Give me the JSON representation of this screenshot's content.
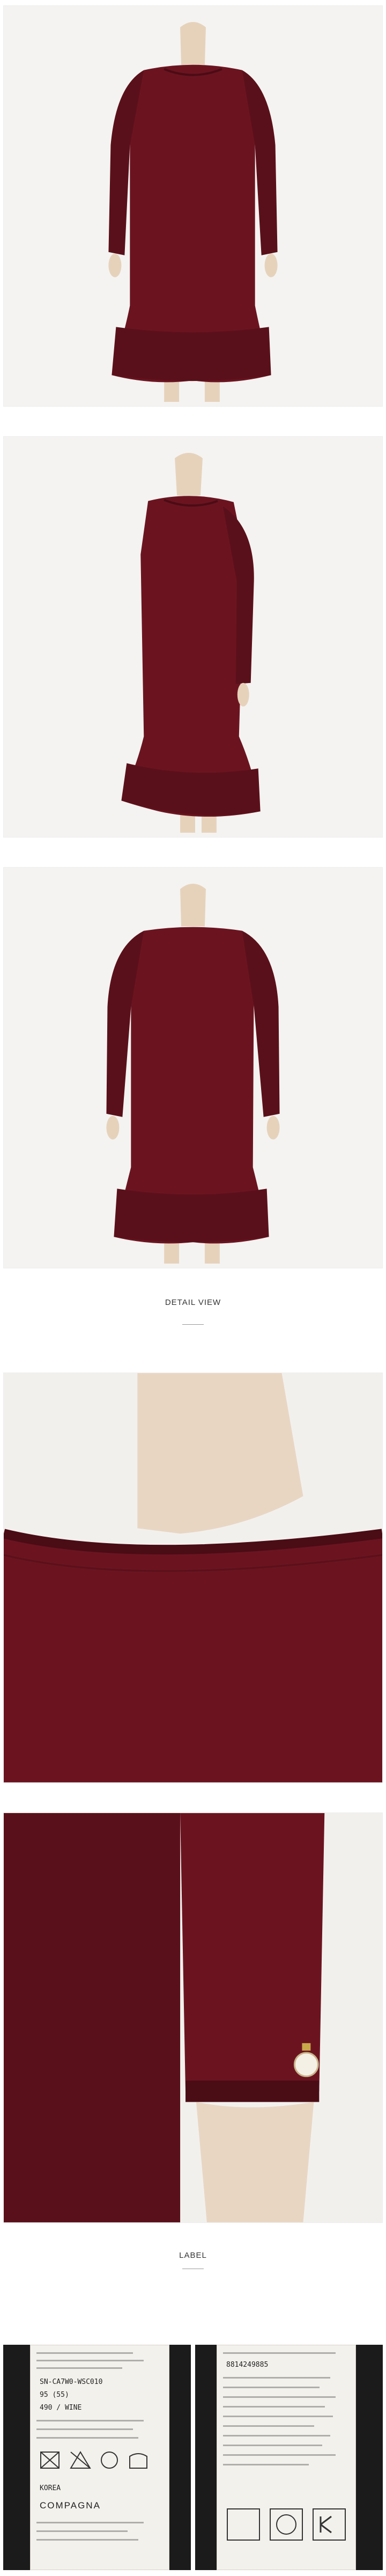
{
  "sections": {
    "detail_title": "DETAIL VIEW",
    "label_title": "LABEL"
  },
  "product": {
    "color_name": "WINE",
    "dress_color": "#6b1420",
    "dress_shadow": "#4a0c15",
    "background": "#f4f3f1"
  },
  "label": {
    "code": "SN-CA7W0-WSC010",
    "size": "95 (55)",
    "color_line": "490 / WINE",
    "origin": "KOREA",
    "brand": "COMPAGNA",
    "barcode_digits": "8814249885"
  },
  "images": [
    {
      "name": "front-view"
    },
    {
      "name": "side-view"
    },
    {
      "name": "back-view"
    },
    {
      "name": "neckline-detail"
    },
    {
      "name": "sleeve-detail"
    },
    {
      "name": "care-label"
    }
  ]
}
